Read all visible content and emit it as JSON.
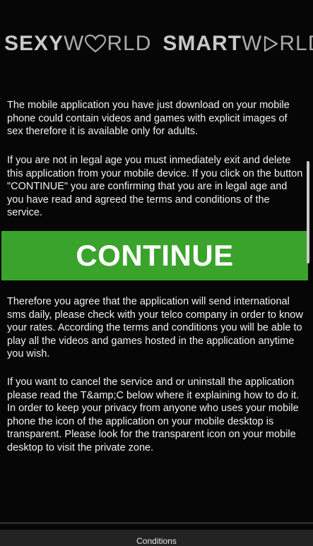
{
  "logos": {
    "sexyworld": {
      "part1": "SEXY",
      "part2": "W",
      "part3": "RLD"
    },
    "smartworld": {
      "part1": "SMART",
      "part2": "W",
      "part3": "RLD"
    },
    "colors": {
      "strong": "#c8c8c8",
      "light": "#a9a9a9"
    },
    "icons": [
      "heart-icon",
      "play-icon"
    ]
  },
  "paragraphs": {
    "p1": "The mobile application you have just download on your mobile phone could contain videos and games with explicit images of sex therefore it is available only for adults.",
    "p2": "If you are not in legal age you must inmediately exit and delete this application from your mobile device. If you click on the button \"CONTINUE\" you are confirming that you are in legal age and you have read and agreed the terms and conditions of the service.",
    "p3": " Therefore you agree that the application will send international sms daily, please check with your telco company in order to know your rates. According the terms and conditions you will be able to play all the videos and games hosted in the application anytime you wish.",
    "p4": "If you want to cancel the service and or uninstall the application please read the T&amp;C below where it explaining how to do it. In order to keep your privacy from anyone who uses your mobile phone the icon of the application on your mobile desktop is transparent. Please look for the transparent icon on your mobile desktop to visit the private zone."
  },
  "continue_button": {
    "label": "CONTINUE",
    "color": "#3aa32b"
  },
  "footer": {
    "conditions_label": "Conditions"
  }
}
